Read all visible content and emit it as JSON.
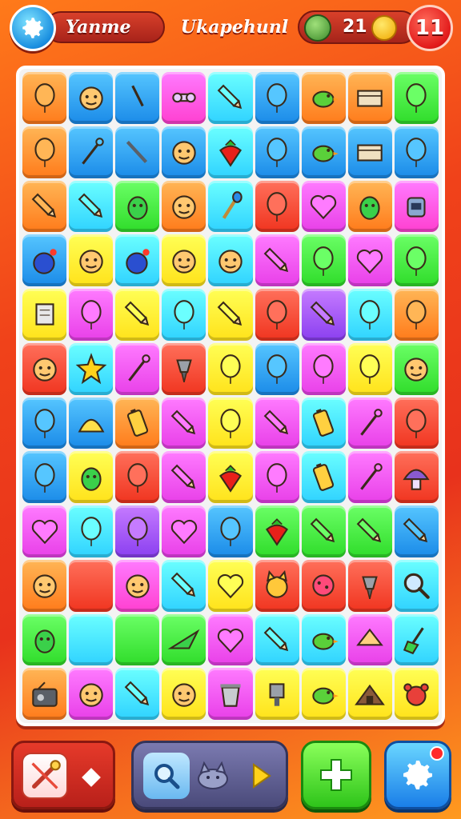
{
  "top_bar": {
    "player_name": "Yanme",
    "title": "Ukapehunl",
    "coin_count": "21",
    "lives": "11",
    "settings_icon": "gear-icon",
    "gem_icon": "green-gem-icon",
    "coin_icon": "gold-coin-icon"
  },
  "colors": {
    "background_top": "#ff7a1a",
    "background_mid": "#e8321c",
    "board": "#f3f3f3",
    "red": "#f0341f",
    "orange": "#ff7a1a",
    "yellow": "#ffe21a",
    "green": "#2fdc2a",
    "cyan": "#2fd2ff",
    "blue": "#1a8ae8",
    "pink": "#ff3fd0",
    "purple": "#8a3ff0",
    "magenta": "#e83fe8"
  },
  "board": {
    "columns": 9,
    "rows": 12,
    "tiles": [
      [
        "orange",
        "blue",
        "blue",
        "pink",
        "cyan",
        "blue",
        "orange",
        "orange",
        "green"
      ],
      [
        "orange",
        "blue",
        "blue",
        "blue",
        "cyan",
        "blue",
        "blue",
        "blue",
        "blue"
      ],
      [
        "orange",
        "cyan",
        "green",
        "orange",
        "cyan",
        "red",
        "magenta",
        "orange",
        "pink"
      ],
      [
        "blue",
        "yellow",
        "cyan",
        "yellow",
        "cyan",
        "magenta",
        "green",
        "magenta",
        "green"
      ],
      [
        "yellow",
        "magenta",
        "yellow",
        "cyan",
        "yellow",
        "red",
        "purple",
        "cyan",
        "orange"
      ],
      [
        "red",
        "cyan",
        "magenta",
        "red",
        "yellow",
        "blue",
        "magenta",
        "yellow",
        "green"
      ],
      [
        "blue",
        "blue",
        "orange",
        "magenta",
        "yellow",
        "magenta",
        "cyan",
        "magenta",
        "red"
      ],
      [
        "blue",
        "yellow",
        "red",
        "magenta",
        "yellow",
        "magenta",
        "cyan",
        "magenta",
        "red"
      ],
      [
        "magenta",
        "cyan",
        "purple",
        "magenta",
        "blue",
        "green",
        "green",
        "green",
        "blue"
      ],
      [
        "orange",
        "red",
        "pink",
        "cyan",
        "yellow",
        "red",
        "red",
        "red",
        "cyan"
      ],
      [
        "green",
        "cyan",
        "green",
        "green",
        "magenta",
        "cyan",
        "cyan",
        "magenta",
        "cyan"
      ],
      [
        "orange",
        "magenta",
        "cyan",
        "yellow",
        "magenta",
        "yellow",
        "yellow",
        "yellow",
        "yellow"
      ]
    ],
    "items": [
      [
        "balloon",
        "face",
        "hook",
        "bone",
        "pencil",
        "balloon",
        "bird",
        "box",
        "balloon"
      ],
      [
        "balloon",
        "pin",
        "knife",
        "face",
        "strawberry",
        "balloon",
        "bird",
        "box",
        "balloon"
      ],
      [
        "pencil",
        "pencil",
        "bug",
        "face",
        "paintbrush",
        "balloon",
        "heart",
        "bug",
        "robot"
      ],
      [
        "bomb",
        "face",
        "bomb",
        "face",
        "face",
        "pencil",
        "balloon",
        "heart",
        "balloon"
      ],
      [
        "scroll",
        "balloon",
        "pencil",
        "balloon",
        "pencil",
        "balloon",
        "pencil",
        "balloon",
        "balloon"
      ],
      [
        "face",
        "star",
        "pin",
        "drill",
        "balloon",
        "balloon",
        "balloon",
        "balloon",
        "face"
      ],
      [
        "balloon",
        "shell",
        "battery",
        "pencil",
        "balloon",
        "pencil",
        "battery",
        "pin",
        "balloon"
      ],
      [
        "balloon",
        "bug",
        "balloon",
        "pencil",
        "strawberry",
        "balloon",
        "battery",
        "pin",
        "mushroom"
      ],
      [
        "heart",
        "balloon",
        "balloon",
        "heart",
        "balloon",
        "strawberry",
        "pencil",
        "pencil",
        "pencil"
      ],
      [
        "face",
        "blank",
        "face",
        "pencil",
        "heart",
        "cat",
        "cookie",
        "drill",
        "magnifier"
      ],
      [
        "bug",
        "blank",
        "blank",
        "plane",
        "heart",
        "pencil",
        "bird",
        "pie",
        "broom"
      ],
      [
        "radio",
        "face",
        "pencil",
        "face",
        "trash",
        "lamp",
        "bird",
        "tent",
        "bear"
      ]
    ]
  },
  "bottom_bar": {
    "tool_icon": "paint-pencil-icon",
    "diamond_icon": "diamond-icon",
    "slot1_icon": "magnifier-icon",
    "slot2_icon": "cat-icon",
    "slot3_icon": "play-arrow-icon",
    "green_icon": "plus-icon",
    "blue_icon": "gear-icon"
  }
}
